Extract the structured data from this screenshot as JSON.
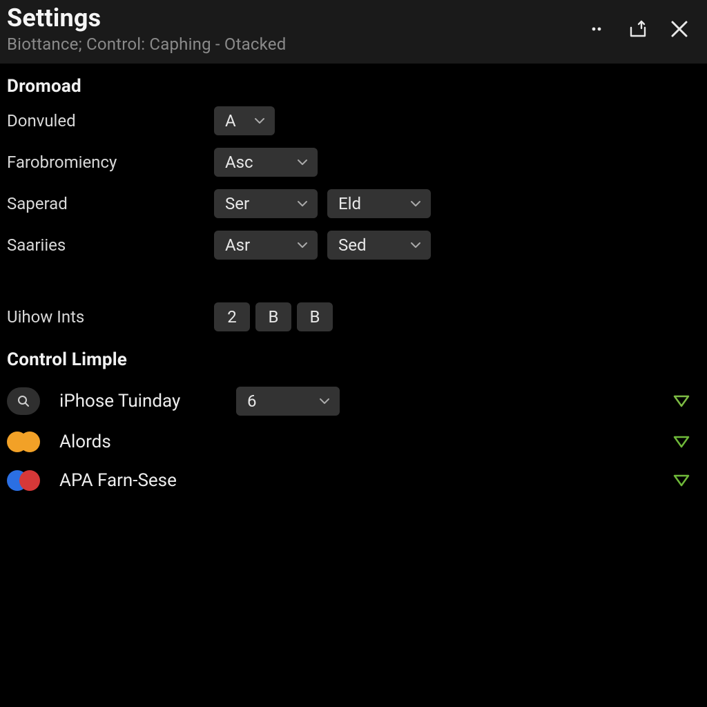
{
  "header": {
    "title": "Settings",
    "subtitle": "Biottance; Control: Caphing - Otacked"
  },
  "section1": {
    "title": "Dromoad",
    "rows": {
      "donvuled": {
        "label": "Donvuled",
        "value": "A"
      },
      "farobromiency": {
        "label": "Farobromiency",
        "value": "Asc"
      },
      "saperad": {
        "label": "Saperad",
        "value1": "Ser",
        "value2": "Eld"
      },
      "saariies": {
        "label": "Saariies",
        "value1": "Asr",
        "value2": "Sed"
      }
    },
    "uihow": {
      "label": "Uihow Ints",
      "pills": [
        "2",
        "B",
        "B"
      ]
    }
  },
  "section2": {
    "title": "Control Limple",
    "items": {
      "iphose": {
        "label": "iPhose Tuinday",
        "select": "6",
        "colors": null
      },
      "alords": {
        "label": "Alords",
        "colors": [
          "#f2a127",
          "#f2a127"
        ]
      },
      "apa": {
        "label": "APA Farn-Sese",
        "colors": [
          "#2b6fe3",
          "#d63838"
        ]
      }
    }
  },
  "colors": {
    "triangle_fill": "#84c94a",
    "triangle_outline": "#6fb93a"
  }
}
